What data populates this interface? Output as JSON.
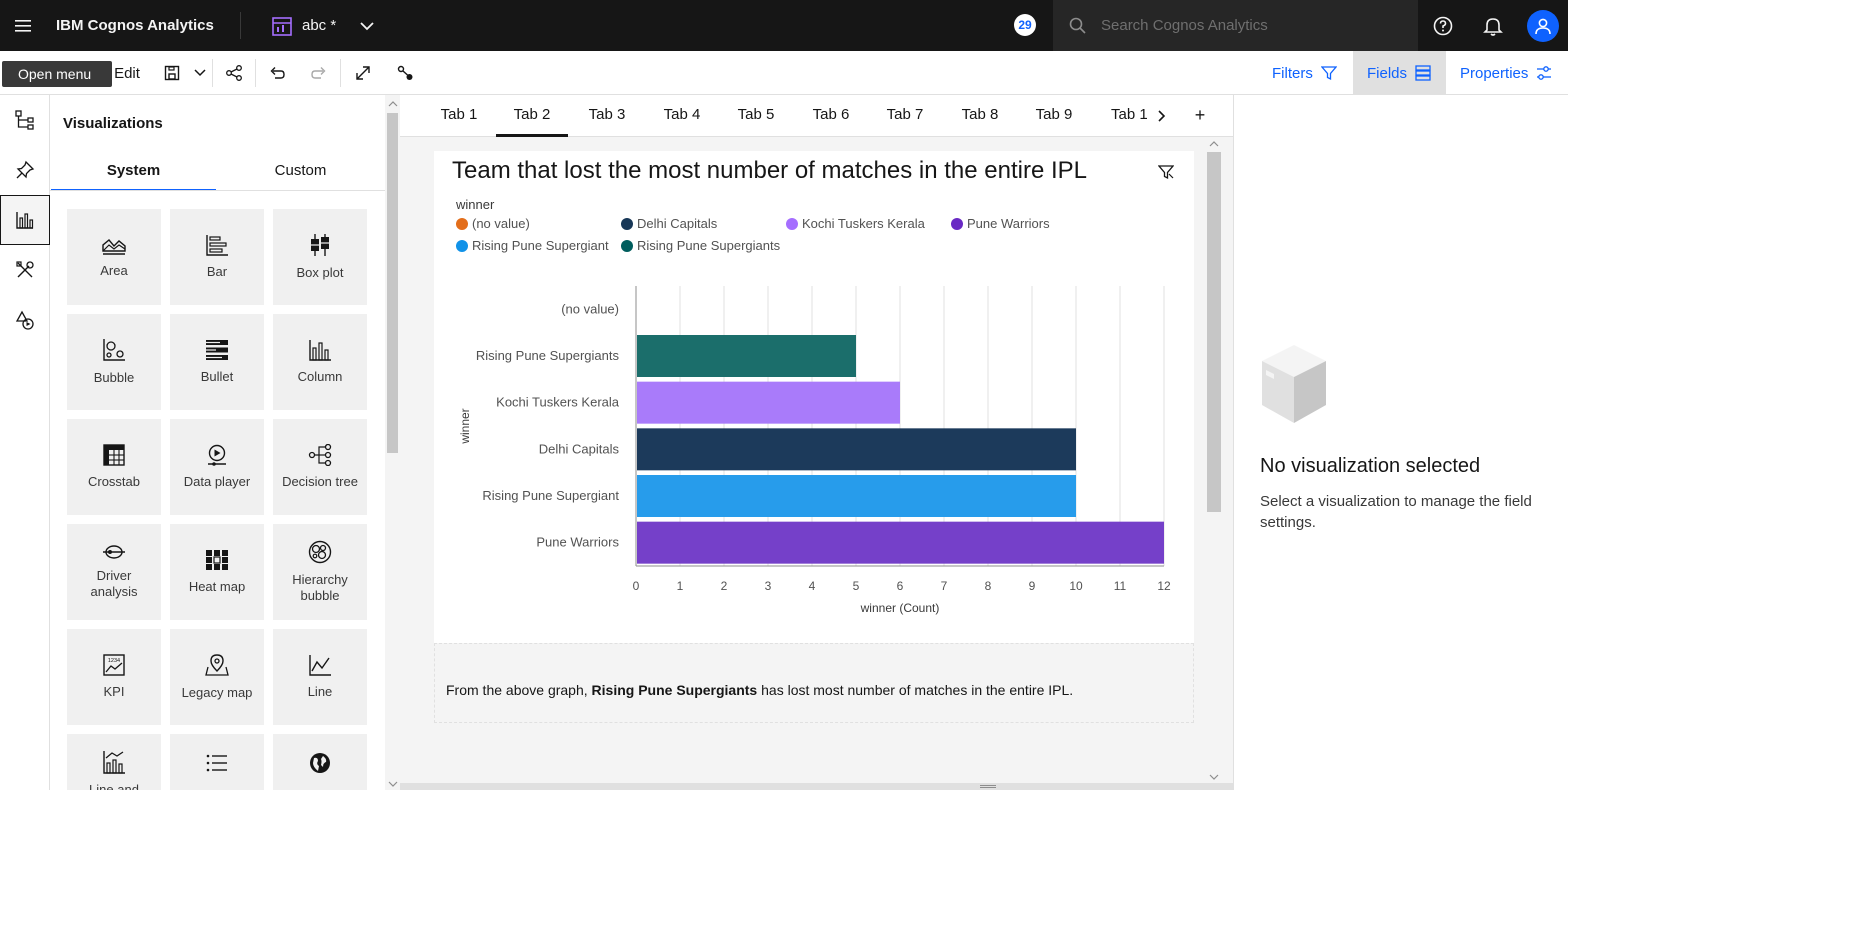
{
  "topbar": {
    "brand": "IBM Cognos Analytics",
    "doc_title": "abc *",
    "badge": "29",
    "search_placeholder": "Search Cognos Analytics"
  },
  "toolbar": {
    "tooltip": "Open menu",
    "edit_label": "Edit",
    "filters_label": "Filters",
    "fields_label": "Fields",
    "properties_label": "Properties"
  },
  "vis_panel": {
    "title": "Visualizations",
    "tabs": [
      "System",
      "Custom"
    ],
    "items": [
      {
        "label": "Area",
        "icon": "area-chart-icon"
      },
      {
        "label": "Bar",
        "icon": "bar-chart-icon"
      },
      {
        "label": "Box plot",
        "icon": "box-plot-icon"
      },
      {
        "label": "Bubble",
        "icon": "bubble-chart-icon"
      },
      {
        "label": "Bullet",
        "icon": "bullet-chart-icon"
      },
      {
        "label": "Column",
        "icon": "column-chart-icon"
      },
      {
        "label": "Crosstab",
        "icon": "crosstab-icon"
      },
      {
        "label": "Data player",
        "icon": "data-player-icon"
      },
      {
        "label": "Decision tree",
        "icon": "decision-tree-icon"
      },
      {
        "label": "Driver analysis",
        "icon": "driver-analysis-icon"
      },
      {
        "label": "Heat map",
        "icon": "heat-map-icon"
      },
      {
        "label": "Hierarchy bubble",
        "icon": "hierarchy-bubble-icon"
      },
      {
        "label": "KPI",
        "icon": "kpi-icon"
      },
      {
        "label": "Legacy map",
        "icon": "legacy-map-icon"
      },
      {
        "label": "Line",
        "icon": "line-chart-icon"
      },
      {
        "label": "Line and",
        "icon": "line-and-column-icon"
      },
      {
        "label": "",
        "icon": "list-icon"
      },
      {
        "label": "",
        "icon": "globe-icon"
      }
    ]
  },
  "canvas": {
    "tabs": [
      "Tab 1",
      "Tab 2",
      "Tab 3",
      "Tab 4",
      "Tab 5",
      "Tab 6",
      "Tab 7",
      "Tab 8",
      "Tab 9",
      "Tab 1"
    ],
    "active_tab": "Tab 2",
    "add_tab": "+",
    "widget_title": "Team that lost the most number of matches in the entire IPL",
    "note": {
      "prefix": "From the above graph, ",
      "bold": "Rising Pune Supergiants",
      "suffix": " has lost most number of matches in the entire IPL."
    }
  },
  "right_panel": {
    "title": "No visualization selected",
    "description": "Select a visualization to manage the field settings."
  },
  "chart_data": {
    "type": "bar",
    "orientation": "horizontal",
    "legend_title": "winner",
    "legend": [
      {
        "name": "(no value)",
        "color": "#e36e1b"
      },
      {
        "name": "Delhi Capitals",
        "color": "#173757"
      },
      {
        "name": "Kochi Tuskers Kerala",
        "color": "#a56eff"
      },
      {
        "name": "Pune Warriors",
        "color": "#6929c4"
      },
      {
        "name": "Rising Pune Supergiant",
        "color": "#1192e8"
      },
      {
        "name": "Rising Pune Supergiants",
        "color": "#005d5d"
      }
    ],
    "categories": [
      "(no value)",
      "Rising Pune Supergiants",
      "Kochi Tuskers Kerala",
      "Delhi Capitals",
      "Rising Pune Supergiant",
      "Pune Warriors"
    ],
    "values": [
      0,
      5,
      6,
      10,
      10,
      12
    ],
    "colors": [
      "#e36e1b",
      "#1b6e6b",
      "#a97bfa",
      "#1c3a5b",
      "#279ceb",
      "#7540c9"
    ],
    "xlabel": "winner (Count)",
    "ylabel": "winner",
    "xlim": [
      0,
      12
    ],
    "xticks": [
      0,
      1,
      2,
      3,
      4,
      5,
      6,
      7,
      8,
      9,
      10,
      11,
      12
    ],
    "grid": true
  }
}
